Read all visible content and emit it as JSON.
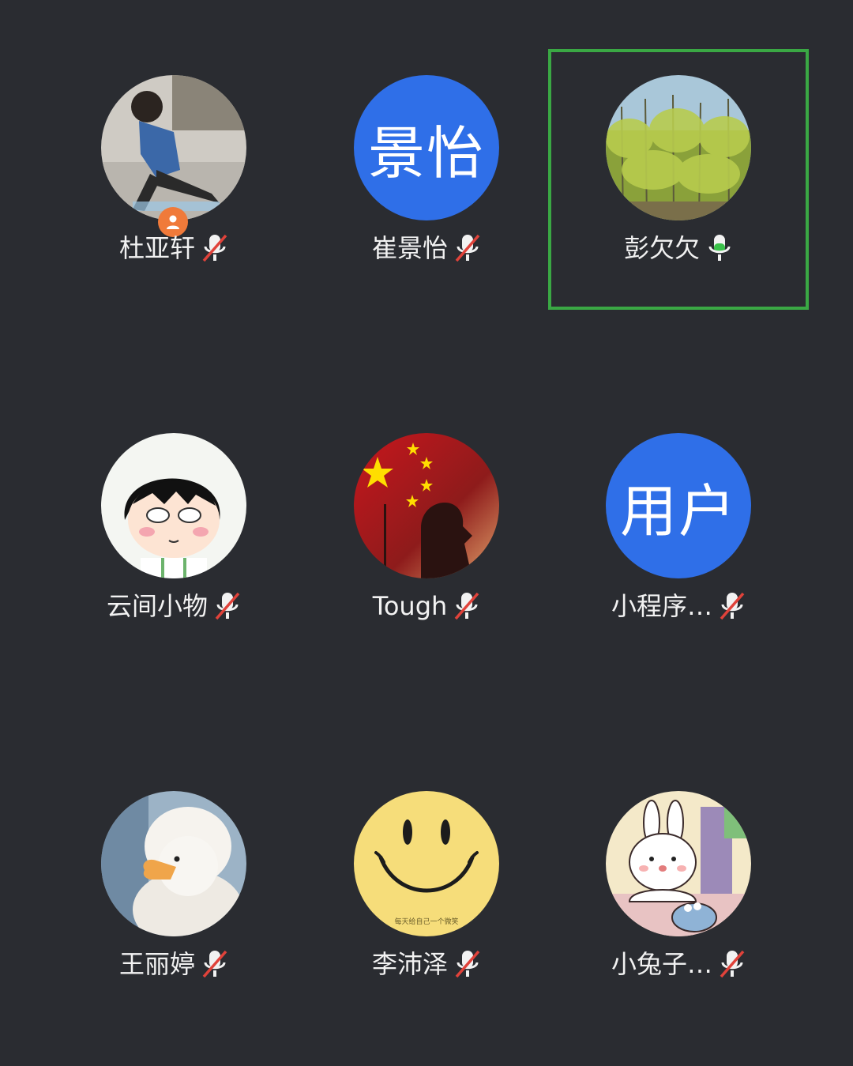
{
  "participants": [
    {
      "name": "杜亚轩",
      "mic": "muted",
      "avatar_icon": "boy-photo-avatar",
      "host": true
    },
    {
      "name": "崔景怡",
      "mic": "muted",
      "avatar_text": "景怡",
      "avatar_color": "#2f6fe8"
    },
    {
      "name": "彭欠欠",
      "mic": "active",
      "avatar_icon": "trees-photo-avatar",
      "speaking": true,
      "highlight_color": "#3aa844"
    },
    {
      "name": "云间小物",
      "mic": "muted",
      "avatar_icon": "cartoon-girl-avatar"
    },
    {
      "name": "Tough",
      "mic": "muted",
      "avatar_icon": "flag-silhouette-avatar"
    },
    {
      "name": "小程序…",
      "mic": "muted",
      "avatar_text": "用户",
      "avatar_color": "#2f6fe8"
    },
    {
      "name": "王丽婷",
      "mic": "muted",
      "avatar_icon": "duck-photo-avatar"
    },
    {
      "name": "李沛泽",
      "mic": "muted",
      "avatar_icon": "smiley-face-avatar",
      "avatar_caption": "每天给自己一个微笑"
    },
    {
      "name": "小兔子…",
      "mic": "muted",
      "avatar_icon": "bunny-cartoon-avatar"
    }
  ],
  "colors": {
    "background": "#2a2c31",
    "mic_muted_slash": "#e0423a",
    "mic_active": "#3ac24a"
  }
}
